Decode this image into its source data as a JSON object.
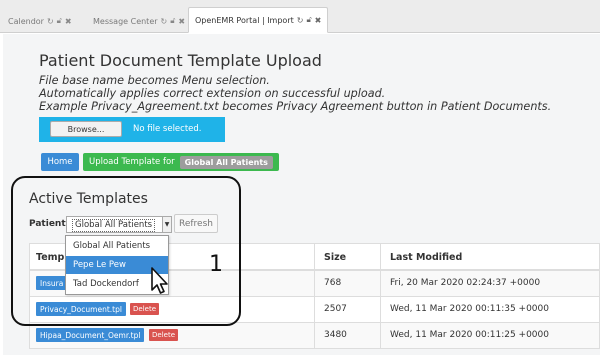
{
  "tabs": [
    {
      "label": "Calendor"
    },
    {
      "label": "Message Center"
    },
    {
      "label": "OpenEMR Portal | Import"
    }
  ],
  "header": {
    "title": "Patient Document Template Upload",
    "desc_lines": [
      "File base name becomes Menu selection.",
      "Automatically applies correct extension on successful upload.",
      "Example Privacy_Agreement.txt becomes Privacy Agreement button in Patient Documents."
    ]
  },
  "upload": {
    "browse_label": "Browse...",
    "file_status": "No file selected."
  },
  "actions": {
    "home_label": "Home",
    "upload_label": "Upload Template for",
    "upload_target": "Global All Patients"
  },
  "templates": {
    "title": "Active Templates",
    "patient_label": "Patient",
    "patient_selected": "Global All Patients",
    "refresh_label": "Refresh",
    "dropdown_options": [
      "Global All Patients",
      "Pepe Le Pew",
      "Tad Dockendorf"
    ],
    "highlighted_option": "Pepe Le Pew"
  },
  "table": {
    "headers": [
      "Templ",
      "Size",
      "Last Modified"
    ],
    "rows": [
      {
        "name": "Insura",
        "size": "768",
        "modified": "Fri, 20 Mar 2020 02:24:37 +0000"
      },
      {
        "name": "Privacy_Document.tpl",
        "size": "2507",
        "modified": "Wed, 11 Mar 2020 00:11:35 +0000"
      },
      {
        "name": "Hipaa_Document_Oemr.tpl",
        "size": "3480",
        "modified": "Wed, 11 Mar 2020 00:11:25 +0000"
      }
    ],
    "delete_label": "Delete"
  },
  "annotation": {
    "number": "1"
  },
  "colors": {
    "primary": "#3a8bd6",
    "success": "#3cb94f",
    "danger": "#d9534f",
    "upload_box": "#1fb3e8"
  }
}
